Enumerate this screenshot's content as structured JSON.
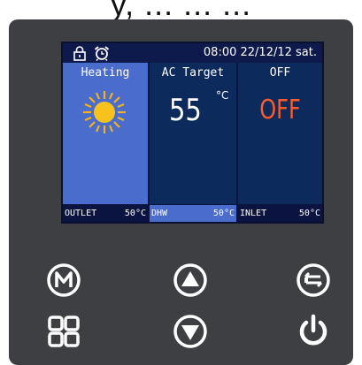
{
  "top_fragment": "y, ... ... ...",
  "status": {
    "icons": [
      "lock-icon",
      "alarm-clock-icon"
    ],
    "datetime": "08:00 22/12/12 sat."
  },
  "columns": [
    {
      "title": "Heating",
      "icon": "sun-icon"
    },
    {
      "title": "AC Target",
      "value": "55",
      "unit": "°C"
    },
    {
      "title": "OFF",
      "value": "OFF"
    }
  ],
  "bottom": [
    {
      "label": "OUTLET",
      "value": "50°C"
    },
    {
      "label": "DHW",
      "value": "50°C"
    },
    {
      "label": "INLET",
      "value": "50°C"
    }
  ],
  "buttons": [
    {
      "name": "mode-button",
      "icon": "m-circle-icon"
    },
    {
      "name": "up-button",
      "icon": "triangle-up-icon"
    },
    {
      "name": "back-button",
      "icon": "return-icon"
    },
    {
      "name": "menu-button",
      "icon": "grid-icon"
    },
    {
      "name": "down-button",
      "icon": "triangle-down-icon"
    },
    {
      "name": "power-button",
      "icon": "power-icon"
    }
  ],
  "colors": {
    "panel": "#3e3f42",
    "screen": "#0b1440",
    "active_column": "#4a6ccc",
    "off_text": "#ff5a2a"
  }
}
